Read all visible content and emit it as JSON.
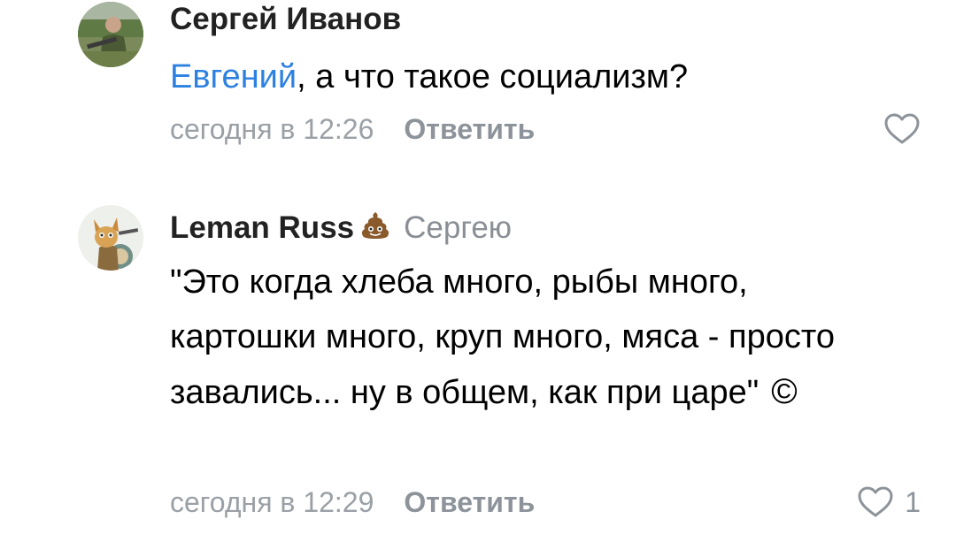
{
  "comments": [
    {
      "author": "Сергей Иванов",
      "mention": "Евгений",
      "text": ", а что такое социализм?",
      "date": "сегодня в 12:26",
      "reply_label": "Ответить",
      "likes": "",
      "avatar_icon": "person-photo-avatar",
      "like_icon": "heart-outline-icon"
    },
    {
      "author": "Leman Russ",
      "author_badge_icon": "poop-emoji-icon",
      "reply_to": "Сергею",
      "text": "\"Это когда хлеба много, рыбы много, картошки много, круп много, мяса - просто завались... ну в общем, как при царе\"",
      "copyright": "©",
      "date": "сегодня в 12:29",
      "reply_label": "Ответить",
      "likes": "1",
      "avatar_icon": "cartoon-warrior-avatar",
      "like_icon": "heart-outline-icon"
    }
  ],
  "colors": {
    "mention": "#2d81e0",
    "meta": "#9aa0a6",
    "author": "#222222",
    "text": "#000000",
    "background": "#ffffff"
  }
}
